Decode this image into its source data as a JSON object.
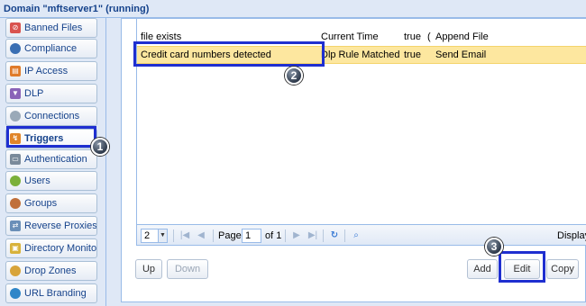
{
  "window": {
    "title": "Domain \"mftserver1\" (running)"
  },
  "sidebar": {
    "items": [
      {
        "label": "Banned Files",
        "icon": "banned-files-icon",
        "color": "#d9534f"
      },
      {
        "label": "Compliance",
        "icon": "compliance-icon",
        "color": "#3a6fb3"
      },
      {
        "label": "IP Access",
        "icon": "ip-access-icon",
        "color": "#e07b2a"
      },
      {
        "label": "DLP",
        "icon": "dlp-icon",
        "color": "#8a63b8"
      },
      {
        "label": "Connections",
        "icon": "connections-icon",
        "color": "#9aa9b8"
      },
      {
        "label": "Triggers",
        "icon": "triggers-icon",
        "color": "#e0852a",
        "active": true
      },
      {
        "label": "Authentication",
        "icon": "authentication-icon",
        "color": "#7a8a9a"
      },
      {
        "label": "Users",
        "icon": "users-icon",
        "color": "#7bb03a"
      },
      {
        "label": "Groups",
        "icon": "groups-icon",
        "color": "#c0703a"
      },
      {
        "label": "Reverse Proxies",
        "icon": "reverse-proxies-icon",
        "color": "#6a8fb8"
      },
      {
        "label": "Directory Monitors",
        "icon": "directory-monitors-icon",
        "color": "#d8b23a"
      },
      {
        "label": "Drop Zones",
        "icon": "drop-zones-icon",
        "color": "#d8a43a"
      },
      {
        "label": "URL Branding",
        "icon": "url-branding-icon",
        "color": "#2f86c8"
      }
    ]
  },
  "grid": {
    "rows": [
      {
        "name": "file exists",
        "event": "Current Time",
        "enabled": "true",
        "flag": "(",
        "action": "Append File",
        "selected": false
      },
      {
        "name": "Credit card numbers detected",
        "event": "Dlp Rule Matched",
        "enabled": "true",
        "flag": "",
        "action": "Send Email",
        "selected": true
      }
    ]
  },
  "paging": {
    "page_size": "2",
    "page_label": "Page",
    "page_value": "1",
    "of_label": "of 1",
    "display_text": "Display"
  },
  "buttons": {
    "up": "Up",
    "down": "Down",
    "add": "Add",
    "edit": "Edit",
    "copy": "Copy"
  },
  "callouts": {
    "one": "1",
    "two": "2",
    "three": "3",
    "color": "#1f2fd0"
  }
}
